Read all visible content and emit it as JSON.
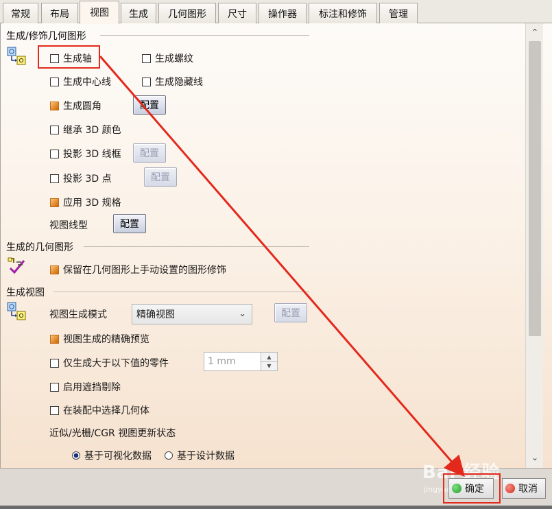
{
  "tabs": [
    "常规",
    "布局",
    "视图",
    "生成",
    "几何图形",
    "尺寸",
    "操作器",
    "标注和修饰",
    "管理"
  ],
  "active_tab": "视图",
  "sections": {
    "generate": {
      "title": "生成/修饰几何图形",
      "gen_axis": "生成轴",
      "gen_thread": "生成螺纹",
      "gen_centerline": "生成中心线",
      "gen_hidden": "生成隐藏线",
      "gen_fillet": "生成圆角",
      "inherit_color": "继承 3D 颜色",
      "project_wireframe": "投影 3D 线框",
      "project_points": "投影 3D 点",
      "apply_spec": "应用 3D 规格",
      "view_linetype": "视图线型",
      "config": "配置"
    },
    "geometry": {
      "title": "生成的几何图形",
      "keep_manual": "保留在几何图形上手动设置的图形修饰"
    },
    "view": {
      "title": "生成视图",
      "mode_label": "视图生成模式",
      "mode_value": "精确视图",
      "exact_preview": "视图生成的精确预览",
      "only_larger": "仅生成大于以下值的零件",
      "size_value": "1 mm",
      "occlusion": "启用遮挡剔除",
      "select_in_assembly": "在装配中选择几何体",
      "update_status": "近似/光栅/CGR 视图更新状态",
      "radio_visual": "基于可视化数据",
      "radio_design": "基于设计数据"
    }
  },
  "checked": {
    "gen_axis": false,
    "gen_thread": false,
    "gen_centerline": false,
    "gen_hidden": false,
    "gen_fillet": true,
    "inherit_color": false,
    "project_wireframe": false,
    "project_points": false,
    "apply_spec": true,
    "keep_manual": true,
    "exact_preview": true,
    "only_larger": false,
    "occlusion": false,
    "select_in_assembly": false
  },
  "footer": {
    "ok": "确定",
    "cancel": "取消"
  },
  "watermark": {
    "main": "Bai 经验",
    "sub": "jingyan.baidu.com"
  },
  "colors": {
    "annotation": "#e3281c",
    "checked": "#e28a2b",
    "ok": "#1f9a2c",
    "cancel": "#d4281c"
  }
}
